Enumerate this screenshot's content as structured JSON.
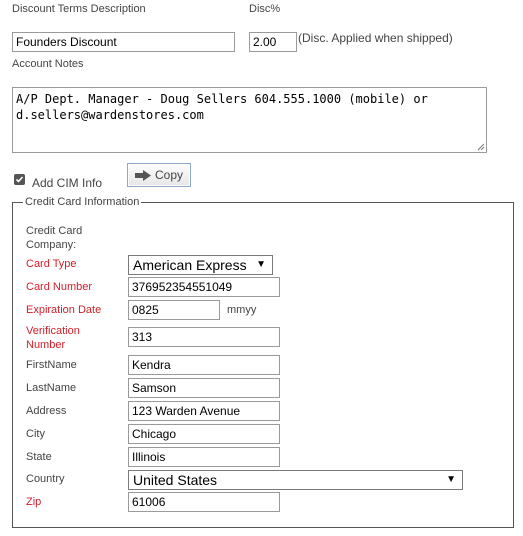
{
  "discount": {
    "terms_label": "Discount Terms Description",
    "terms_value": "Founders Discount",
    "disc_label": "Disc%",
    "disc_value": "2.00",
    "disc_note": "(Disc. Applied when shipped)"
  },
  "account_notes": {
    "label": "Account Notes",
    "value": "A/P Dept. Manager - Doug Sellers 604.555.1000 (mobile) or d.sellers@wardenstores.com"
  },
  "cim": {
    "checkbox_label": "Add CIM Info",
    "checked": true,
    "copy_label": "Copy",
    "copy_icon": "right-arrow-icon"
  },
  "credit_card": {
    "legend": "Credit Card Information",
    "company_label_line1": "Credit Card",
    "company_label_line2": "Company:",
    "card_type_label": "Card Type",
    "card_type_value": "American Express",
    "card_number_label": "Card Number",
    "card_number_value": "376952354551049",
    "expiration_label": "Expiration Date",
    "expiration_value": "0825",
    "expiration_hint": "mmyy",
    "verification_label_line1": "Verification",
    "verification_label_line2": "Number",
    "verification_value": "313",
    "first_name_label": "FirstName",
    "first_name_value": "Kendra",
    "last_name_label": "LastName",
    "last_name_value": "Samson",
    "address_label": "Address",
    "address_value": "123 Warden Avenue",
    "city_label": "City",
    "city_value": "Chicago",
    "state_label": "State",
    "state_value": "Illinois",
    "country_label": "Country",
    "country_value": "United States",
    "zip_label": "Zip",
    "zip_value": "61006"
  },
  "colors": {
    "required_label": "#d0202a",
    "text": "#444444",
    "border": "#9a9a9a"
  }
}
